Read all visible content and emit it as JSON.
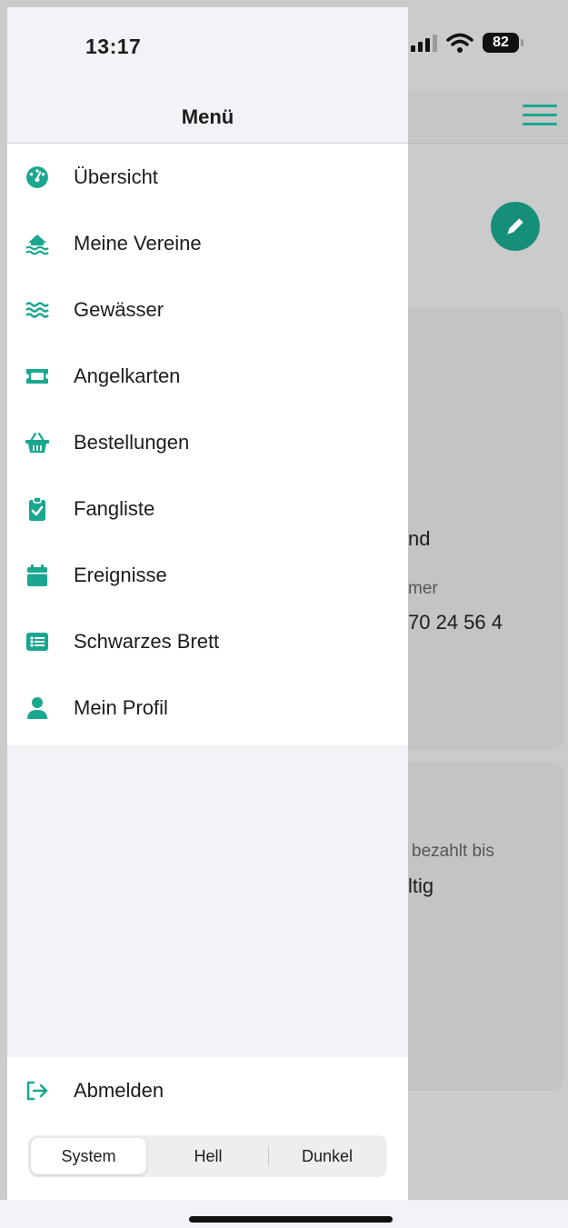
{
  "status_bar": {
    "time": "13:17",
    "battery": "82"
  },
  "drawer": {
    "title": "Menü",
    "items": [
      {
        "label": "Übersicht",
        "icon": "dashboard-gauge-icon"
      },
      {
        "label": "Meine Vereine",
        "icon": "clubhouse-water-icon"
      },
      {
        "label": "Gewässer",
        "icon": "water-waves-icon"
      },
      {
        "label": "Angelkarten",
        "icon": "ticket-icon"
      },
      {
        "label": "Bestellungen",
        "icon": "shopping-basket-icon"
      },
      {
        "label": "Fangliste",
        "icon": "clipboard-check-icon"
      },
      {
        "label": "Ereignisse",
        "icon": "calendar-icon"
      },
      {
        "label": "Schwarzes Brett",
        "icon": "list-board-icon"
      },
      {
        "label": "Mein Profil",
        "icon": "user-icon"
      }
    ],
    "logout_label": "Abmelden",
    "theme_options": [
      "System",
      "Hell",
      "Dunkel"
    ],
    "theme_selected": "System"
  },
  "background": {
    "card1_line1": "nd",
    "card1_line2": "mer",
    "card1_line3": "70 24 56 4",
    "card2_line1": "bezahlt bis",
    "card2_line2": "ltig"
  },
  "colors": {
    "accent": "#1aa78f",
    "fab": "#168f79"
  }
}
